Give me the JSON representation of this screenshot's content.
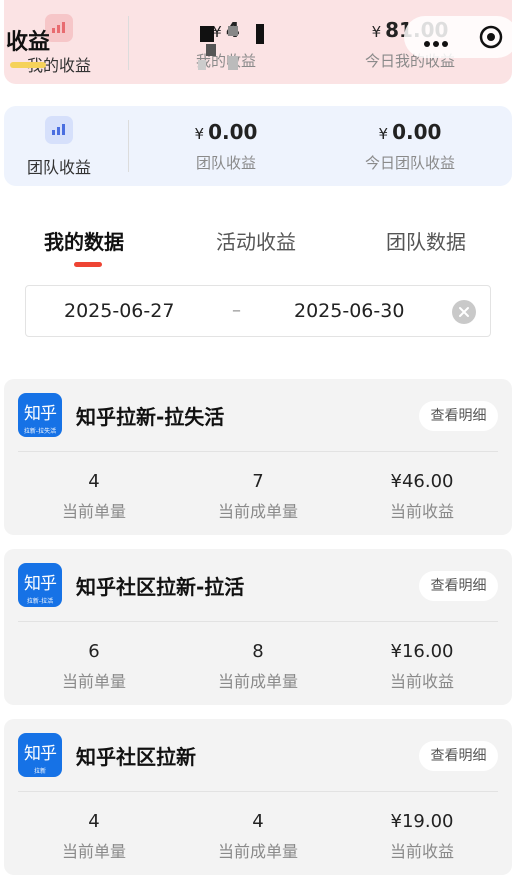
{
  "my_summary": {
    "label": "我的收益",
    "total": {
      "currency": "¥",
      "value": "4",
      "label": "我的收益"
    },
    "today": {
      "currency": "¥",
      "value": "81.00",
      "label": "今日我的收益"
    }
  },
  "overlay_title": "收益",
  "team_summary": {
    "label": "团队收益",
    "total": {
      "currency": "¥",
      "value": "0.00",
      "label": "团队收益"
    },
    "today": {
      "currency": "¥",
      "value": "0.00",
      "label": "今日团队收益"
    }
  },
  "tabs": [
    {
      "label": "我的数据",
      "active": true
    },
    {
      "label": "活动收益",
      "active": false
    },
    {
      "label": "团队数据",
      "active": false
    }
  ],
  "date_range": {
    "start": "2025-06-27",
    "separator": "–",
    "end": "2025-06-30"
  },
  "items": [
    {
      "icon_text": "知乎",
      "icon_caption": "拉新-拉失活",
      "title": "知乎拉新-拉失活",
      "detail_label": "查看明细",
      "stats": [
        {
          "value": "4",
          "label": "当前单量"
        },
        {
          "value": "7",
          "label": "当前成单量"
        },
        {
          "value": "¥46.00",
          "label": "当前收益"
        }
      ]
    },
    {
      "icon_text": "知乎",
      "icon_caption": "拉新-拉活",
      "title": "知乎社区拉新-拉活",
      "detail_label": "查看明细",
      "stats": [
        {
          "value": "6",
          "label": "当前单量"
        },
        {
          "value": "8",
          "label": "当前成单量"
        },
        {
          "value": "¥16.00",
          "label": "当前收益"
        }
      ]
    },
    {
      "icon_text": "知乎",
      "icon_caption": "拉新",
      "title": "知乎社区拉新",
      "detail_label": "查看明细",
      "stats": [
        {
          "value": "4",
          "label": "当前单量"
        },
        {
          "value": "4",
          "label": "当前成单量"
        },
        {
          "value": "¥19.00",
          "label": "当前收益"
        }
      ]
    }
  ],
  "colors": {
    "accent": "#ee4433",
    "brand": "#1672e6",
    "my_bg": "#fbe3e4",
    "team_bg": "#eef3fd"
  }
}
